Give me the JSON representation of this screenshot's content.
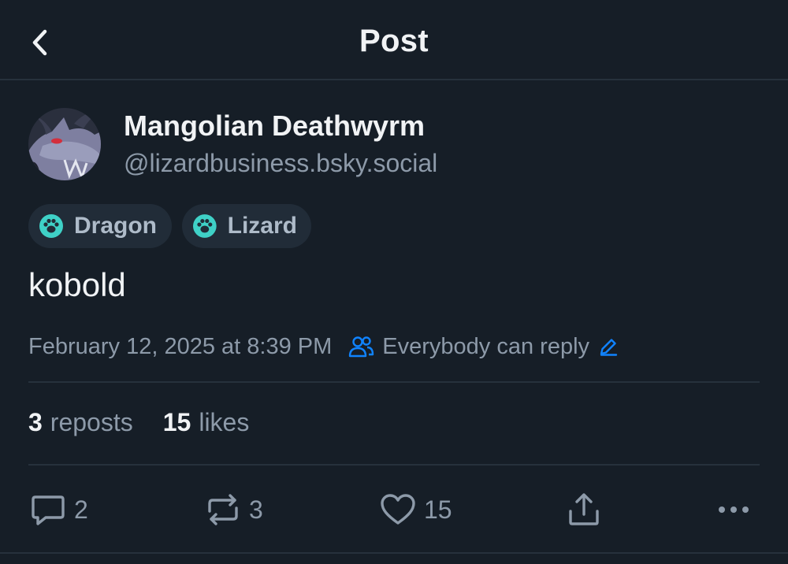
{
  "header": {
    "title": "Post",
    "back_icon": "chevron-left-icon"
  },
  "author": {
    "display_name": "Mangolian Deathwyrm",
    "handle": "@lizardbusiness.bsky.social",
    "avatar": "dragon-avatar"
  },
  "tags": [
    {
      "label": "Dragon",
      "icon": "paw-icon"
    },
    {
      "label": "Lizard",
      "icon": "paw-icon"
    }
  ],
  "post": {
    "text": "kobold",
    "timestamp": "February 12, 2025 at 8:39 PM",
    "reply_setting": "Everybody can reply"
  },
  "stats": {
    "reposts_count": "3",
    "reposts_label": "reposts",
    "likes_count": "15",
    "likes_label": "likes"
  },
  "actions": {
    "reply_count": "2",
    "repost_count": "3",
    "like_count": "15"
  },
  "colors": {
    "background": "#161e27",
    "accent": "#1083fe",
    "tag_icon": "#3fd1c7",
    "muted_text": "#8d9aa9"
  }
}
